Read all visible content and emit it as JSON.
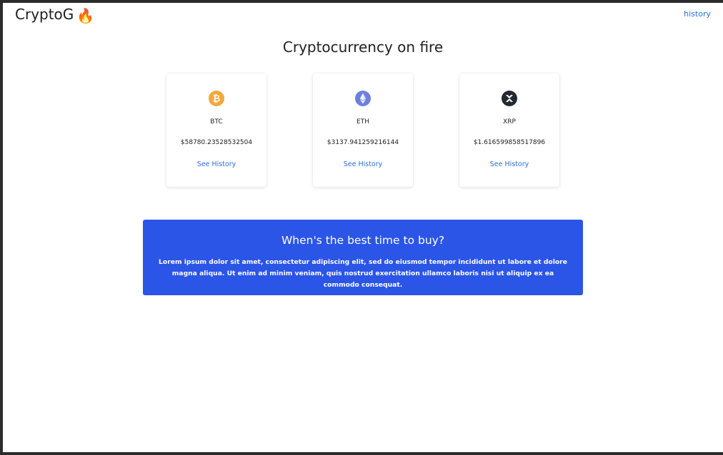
{
  "navbar": {
    "brand": "CryptoG",
    "brand_emoji": "🔥",
    "history_link": "history"
  },
  "hero": {
    "title": "Cryptocurrency on fire"
  },
  "coins": [
    {
      "symbol": "BTC",
      "price": "$58780.23528532504",
      "link": "See History",
      "icon": "bitcoin-icon",
      "color": "#f2a93b"
    },
    {
      "symbol": "ETH",
      "price": "$3137.941259216144",
      "link": "See History",
      "icon": "ethereum-icon",
      "color": "#6f7fe0"
    },
    {
      "symbol": "XRP",
      "price": "$1.616599858517896",
      "link": "See History",
      "icon": "xrp-icon",
      "color": "#23292f"
    }
  ],
  "promo": {
    "title": "When's the best time to buy?",
    "body": "Lorem ipsum dolor sit amet, consectetur adipiscing elit, sed do eiusmod tempor incididunt ut labore et dolore magna aliqua. Ut enim ad minim veniam, quis nostrud exercitation ullamco laboris nisi ut aliquip ex ea commodo consequat.",
    "background": "#2b55e6"
  },
  "colors": {
    "link": "#2a6fd6",
    "text": "#222222"
  }
}
